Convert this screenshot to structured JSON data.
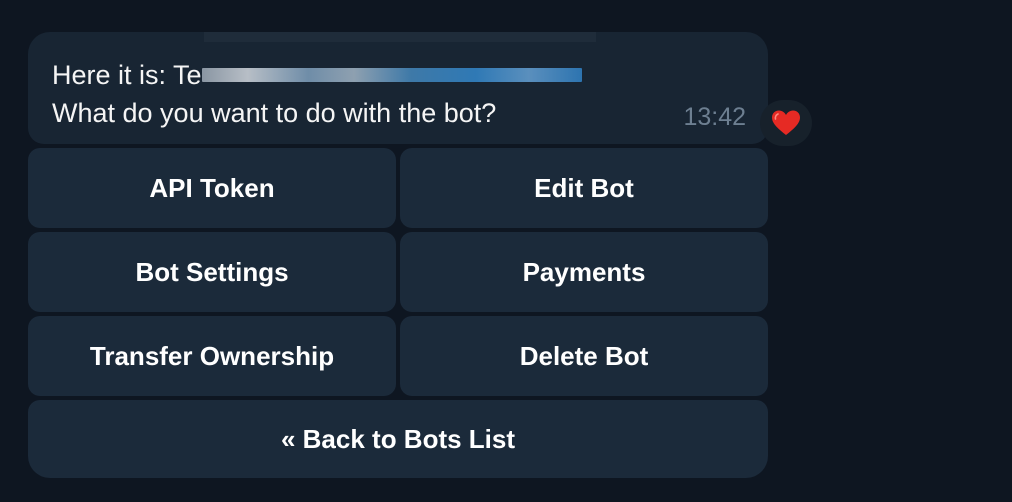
{
  "message": {
    "line1_prefix": "Here it is: Te",
    "line2": "What do you want to do with the bot?",
    "time": "13:42"
  },
  "reaction": {
    "icon": "heart-icon",
    "emoji": "❤️",
    "color": "#e62a24"
  },
  "keyboard": {
    "buttons": [
      {
        "label": "API Token"
      },
      {
        "label": "Edit Bot"
      },
      {
        "label": "Bot Settings"
      },
      {
        "label": "Payments"
      },
      {
        "label": "Transfer Ownership"
      },
      {
        "label": "Delete Bot"
      },
      {
        "label": "« Back to Bots List"
      }
    ]
  },
  "colors": {
    "background": "#0e1621",
    "bubble": "#182533",
    "button": "#1b2a3a",
    "time": "#6d7f91"
  }
}
